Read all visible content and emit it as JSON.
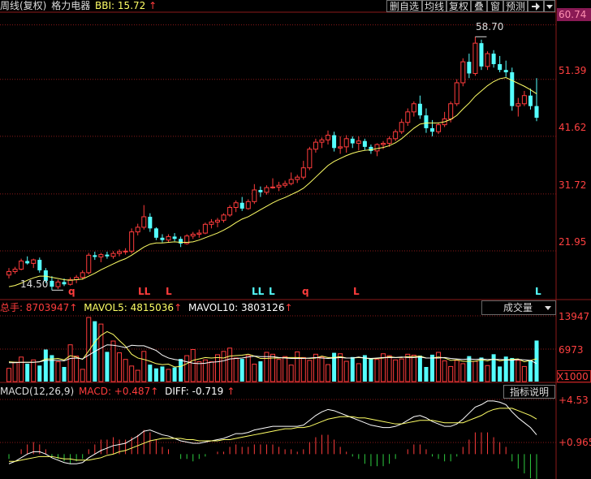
{
  "header": {
    "title": "周线(复权)",
    "stock_name": "格力电器",
    "indicator_label": "BBI:",
    "indicator_value": "15.72",
    "up_arrow": "↑"
  },
  "toolbar": {
    "buttons": [
      "删自选",
      "均线",
      "复权",
      "叠",
      "窗",
      "预测"
    ],
    "pin_icon": "pin-icon",
    "dropdown_icon": "triangle-down-icon"
  },
  "price_axis": {
    "top_value": "60.74",
    "ticks": [
      "51.39",
      "41.62",
      "31.72",
      "21.95"
    ]
  },
  "annotations": {
    "high_label": "58.70",
    "low_label": "14.50",
    "signals": [
      "q",
      "LL",
      "L",
      "LL",
      "L",
      "q",
      "L",
      "L"
    ]
  },
  "volume": {
    "total_label": "总手: 8703947",
    "mavol5_label": "MAVOL5: 4815036",
    "mavol10_label": "MAVOL10: 3803126",
    "selector": "成交量",
    "ticks": [
      "13947",
      "6973",
      "X1000"
    ]
  },
  "macd": {
    "title": "MACD(12,26,9)",
    "macd_label": "MACD: +0.487",
    "diff_label": "DIFF: -0.719",
    "button": "指标说明",
    "ticks": [
      "+4.53",
      "+0.965"
    ]
  },
  "colors": {
    "up": "#ff3c3c",
    "down": "#54ffff",
    "ma": "#ffff66",
    "white": "#ffffff",
    "axis_red": "#ff4040",
    "grid": "#8b1a1a",
    "highlight": "#8a1a55"
  },
  "chart_data": {
    "type": "candlestick",
    "ohlc": [
      [
        17.8,
        19.0,
        17.2,
        18.4
      ],
      [
        18.4,
        19.2,
        18.0,
        18.8
      ],
      [
        18.8,
        20.6,
        18.6,
        20.2
      ],
      [
        20.2,
        21.0,
        19.6,
        19.8
      ],
      [
        19.8,
        20.6,
        19.0,
        20.4
      ],
      [
        20.4,
        20.8,
        18.2,
        18.6
      ],
      [
        18.6,
        19.0,
        16.4,
        16.8
      ],
      [
        16.8,
        17.6,
        15.2,
        15.8
      ],
      [
        15.8,
        17.0,
        15.4,
        16.6
      ],
      [
        16.6,
        17.2,
        15.9,
        16.2
      ],
      [
        16.2,
        17.4,
        16.0,
        17.0
      ],
      [
        17.0,
        17.8,
        16.4,
        17.4
      ],
      [
        17.4,
        18.6,
        17.0,
        18.2
      ],
      [
        18.2,
        21.6,
        17.9,
        21.2
      ],
      [
        21.2,
        21.8,
        20.4,
        20.9
      ],
      [
        20.9,
        21.6,
        20.0,
        21.3
      ],
      [
        21.3,
        21.8,
        20.6,
        21.0
      ],
      [
        21.0,
        21.9,
        20.6,
        21.5
      ],
      [
        21.5,
        22.2,
        21.0,
        21.8
      ],
      [
        21.8,
        22.4,
        21.3,
        21.9
      ],
      [
        21.9,
        25.8,
        21.5,
        25.2
      ],
      [
        25.2,
        26.6,
        24.6,
        26.0
      ],
      [
        26.0,
        29.8,
        25.6,
        27.8
      ],
      [
        27.8,
        28.4,
        25.2,
        25.8
      ],
      [
        25.8,
        26.0,
        23.8,
        24.2
      ],
      [
        24.2,
        24.8,
        23.4,
        23.8
      ],
      [
        23.8,
        24.8,
        23.4,
        24.4
      ],
      [
        24.4,
        25.0,
        23.6,
        24.0
      ],
      [
        24.0,
        24.4,
        22.6,
        23.2
      ],
      [
        23.2,
        24.8,
        23.0,
        24.5
      ],
      [
        24.5,
        25.2,
        24.0,
        24.8
      ],
      [
        24.8,
        25.6,
        24.2,
        25.0
      ],
      [
        25.0,
        26.8,
        24.8,
        26.5
      ],
      [
        26.5,
        27.4,
        25.8,
        26.9
      ],
      [
        26.9,
        27.6,
        26.0,
        27.2
      ],
      [
        27.2,
        28.4,
        26.8,
        28.1
      ],
      [
        28.1,
        29.8,
        27.8,
        29.4
      ],
      [
        29.4,
        30.6,
        28.6,
        30.2
      ],
      [
        30.2,
        31.2,
        28.8,
        29.2
      ],
      [
        29.2,
        30.8,
        29.0,
        30.4
      ],
      [
        30.4,
        33.4,
        30.0,
        32.4
      ],
      [
        32.4,
        33.0,
        31.2,
        32.0
      ],
      [
        32.0,
        33.2,
        31.6,
        32.8
      ],
      [
        32.8,
        34.4,
        32.6,
        32.9
      ],
      [
        32.9,
        33.8,
        32.2,
        33.2
      ],
      [
        33.2,
        34.0,
        32.8,
        33.5
      ],
      [
        33.5,
        35.4,
        33.2,
        34.2
      ],
      [
        34.2,
        35.0,
        33.6,
        34.6
      ],
      [
        34.6,
        37.4,
        34.2,
        36.2
      ],
      [
        36.2,
        39.8,
        35.8,
        39.4
      ],
      [
        39.4,
        41.2,
        38.8,
        40.6
      ],
      [
        40.6,
        41.4,
        39.6,
        41.0
      ],
      [
        41.0,
        42.6,
        40.2,
        41.8
      ],
      [
        41.8,
        42.4,
        39.0,
        39.6
      ],
      [
        39.6,
        41.6,
        38.6,
        39.8
      ],
      [
        39.8,
        41.8,
        38.8,
        41.2
      ],
      [
        41.2,
        41.6,
        39.6,
        40.4
      ],
      [
        40.4,
        41.6,
        39.2,
        40.8
      ],
      [
        40.8,
        41.2,
        39.2,
        39.8
      ],
      [
        39.8,
        40.2,
        38.6,
        39.1
      ],
      [
        39.1,
        40.4,
        38.2,
        40.2
      ],
      [
        40.2,
        40.8,
        39.4,
        40.4
      ],
      [
        40.4,
        41.6,
        39.8,
        41.2
      ],
      [
        41.2,
        42.8,
        40.8,
        42.4
      ],
      [
        42.4,
        44.6,
        42.0,
        44.0
      ],
      [
        44.0,
        46.4,
        43.4,
        45.8
      ],
      [
        45.8,
        47.6,
        45.0,
        47.2
      ],
      [
        47.2,
        48.6,
        44.6,
        45.2
      ],
      [
        45.2,
        46.4,
        42.2,
        43.0
      ],
      [
        43.0,
        44.4,
        41.6,
        42.4
      ],
      [
        42.4,
        44.0,
        42.0,
        43.6
      ],
      [
        43.6,
        45.8,
        43.2,
        44.6
      ],
      [
        44.6,
        47.6,
        44.0,
        47.2
      ],
      [
        47.2,
        51.4,
        46.8,
        50.8
      ],
      [
        50.8,
        55.0,
        50.2,
        54.4
      ],
      [
        54.4,
        55.8,
        51.6,
        52.4
      ],
      [
        52.4,
        58.7,
        52.0,
        57.6
      ],
      [
        57.6,
        58.2,
        53.0,
        53.6
      ],
      [
        53.6,
        56.2,
        53.0,
        55.8
      ],
      [
        55.8,
        56.4,
        53.4,
        54.0
      ],
      [
        54.0,
        55.4,
        52.6,
        53.0
      ],
      [
        53.0,
        54.6,
        51.8,
        52.6
      ],
      [
        52.6,
        53.4,
        46.0,
        46.8
      ],
      [
        46.8,
        48.2,
        45.0,
        47.2
      ],
      [
        47.2,
        49.4,
        46.8,
        48.6
      ],
      [
        48.6,
        49.8,
        46.2,
        46.8
      ],
      [
        46.8,
        51.6,
        44.2,
        44.8
      ]
    ],
    "bbi": [
      15.8,
      16.0,
      16.4,
      16.9,
      17.3,
      17.6,
      17.6,
      17.4,
      17.2,
      17.0,
      16.9,
      17.0,
      17.1,
      17.6,
      18.1,
      18.7,
      19.2,
      19.7,
      20.2,
      20.6,
      21.2,
      21.9,
      22.6,
      23.1,
      23.3,
      23.3,
      23.4,
      23.5,
      23.4,
      23.4,
      23.5,
      23.8,
      24.2,
      24.6,
      25.0,
      25.5,
      26.1,
      26.8,
      27.4,
      27.8,
      28.4,
      29.0,
      29.6,
      30.2,
      30.7,
      31.1,
      31.6,
      32.1,
      32.7,
      33.6,
      34.6,
      35.6,
      36.6,
      37.3,
      37.8,
      38.3,
      38.7,
      39.0,
      39.2,
      39.3,
      39.5,
      39.7,
      40.0,
      40.5,
      41.2,
      42.1,
      43.0,
      43.7,
      43.9,
      43.9,
      43.9,
      44.1,
      44.5,
      45.2,
      46.3,
      47.3,
      48.5,
      49.4,
      50.3,
      51.0,
      51.5,
      51.7,
      51.2,
      50.7,
      50.2,
      49.6,
      48.9
    ],
    "volume": [
      2800,
      4100,
      5200,
      3800,
      4600,
      3400,
      6800,
      5600,
      4200,
      3100,
      7800,
      5400,
      2600,
      13600,
      12800,
      12200,
      6300,
      8600,
      6100,
      4700,
      3300,
      2400,
      6400,
      3600,
      2800,
      3200,
      2600,
      3000,
      4800,
      5500,
      6800,
      4200,
      4600,
      4200,
      5700,
      6400,
      7100,
      5000,
      4800,
      5500,
      3700,
      4300,
      6200,
      5800,
      4700,
      5300,
      3500,
      6300,
      5100,
      4500,
      5800,
      5200,
      3600,
      6100,
      5900,
      4300,
      5200,
      3800,
      5600,
      5000,
      4700,
      5900,
      5500,
      4600,
      4800,
      5800,
      5600,
      5500,
      3100,
      5700,
      6200,
      4400,
      3200,
      4500,
      3800,
      5400,
      4300,
      5100,
      3400,
      5800,
      3200,
      5300,
      5000,
      4500,
      3200,
      4500,
      8703
    ],
    "mavol5": [
      4200,
      4100,
      4100,
      4100,
      4100,
      4200,
      4800,
      4800,
      4900,
      4600,
      5500,
      5200,
      4700,
      6500,
      8400,
      9800,
      10600,
      10000,
      8700,
      7500,
      5800,
      5000,
      4700,
      4300,
      3800,
      3600,
      3700,
      3100,
      3200,
      3800,
      4500,
      4800,
      5100,
      5000,
      5100,
      5000,
      5400,
      5500,
      5600,
      5800,
      5400,
      4900,
      4900,
      5000,
      5000,
      5100,
      5100,
      5100,
      5000,
      4900,
      5000,
      5400,
      5100,
      5100,
      5300,
      5000,
      5000,
      5100,
      5000,
      4800,
      4900,
      5000,
      5300,
      5100,
      5100,
      5300,
      5300,
      5400,
      5000,
      5000,
      5200,
      5000,
      4500,
      4600,
      4300,
      4300,
      4300,
      4600,
      4400,
      4800,
      4400,
      4600,
      4700,
      4800,
      4200,
      4500,
      4815
    ],
    "mavol10": [
      4000,
      4000,
      4100,
      4100,
      4100,
      4200,
      4500,
      4500,
      4500,
      4400,
      4900,
      5000,
      4800,
      5600,
      6400,
      7100,
      7800,
      7700,
      7500,
      7200,
      7700,
      7600,
      7600,
      7100,
      6600,
      5600,
      5000,
      4700,
      4500,
      4200,
      3900,
      3800,
      3900,
      4100,
      4200,
      4400,
      4800,
      4900,
      5000,
      5200,
      5400,
      5300,
      5300,
      5300,
      5100,
      5000,
      4900,
      4900,
      4900,
      5000,
      5100,
      5000,
      4900,
      5000,
      5100,
      5000,
      5000,
      5200,
      5000,
      4900,
      5000,
      5100,
      5100,
      5100,
      5200,
      5100,
      5100,
      5200,
      5000,
      5000,
      5000,
      5100,
      4900,
      4800,
      4700,
      4800,
      4700,
      4800,
      4700,
      4700,
      4700,
      4600,
      4500,
      4700,
      4600,
      4500,
      3803
    ],
    "dif": [
      -0.8,
      -0.6,
      -0.3,
      0.0,
      0.2,
      0.2,
      0.0,
      -0.3,
      -0.5,
      -0.7,
      -0.8,
      -0.8,
      -0.7,
      -0.3,
      0.0,
      0.3,
      0.5,
      0.7,
      0.8,
      0.9,
      1.2,
      1.5,
      1.9,
      2.0,
      1.8,
      1.6,
      1.5,
      1.3,
      1.1,
      1.0,
      0.9,
      0.9,
      1.0,
      1.1,
      1.2,
      1.3,
      1.5,
      1.7,
      1.7,
      1.8,
      2.0,
      2.1,
      2.2,
      2.3,
      2.3,
      2.3,
      2.3,
      2.3,
      2.4,
      2.8,
      3.2,
      3.5,
      3.7,
      3.6,
      3.4,
      3.2,
      3.0,
      2.8,
      2.6,
      2.4,
      2.3,
      2.2,
      2.2,
      2.3,
      2.5,
      2.8,
      3.1,
      3.2,
      3.0,
      2.7,
      2.5,
      2.3,
      2.3,
      2.5,
      2.9,
      3.4,
      3.9,
      4.1,
      4.4,
      4.4,
      4.3,
      4.1,
      3.5,
      3.0,
      2.6,
      2.2,
      1.6
    ],
    "dea": [
      -0.6,
      -0.6,
      -0.5,
      -0.4,
      -0.3,
      -0.2,
      -0.2,
      -0.2,
      -0.3,
      -0.4,
      -0.4,
      -0.5,
      -0.5,
      -0.5,
      -0.4,
      -0.3,
      -0.1,
      0.0,
      0.2,
      0.3,
      0.5,
      0.7,
      0.9,
      1.1,
      1.2,
      1.3,
      1.3,
      1.3,
      1.3,
      1.2,
      1.2,
      1.1,
      1.1,
      1.1,
      1.1,
      1.2,
      1.2,
      1.3,
      1.4,
      1.5,
      1.6,
      1.7,
      1.8,
      1.9,
      2.0,
      2.1,
      2.1,
      2.2,
      2.2,
      2.3,
      2.5,
      2.7,
      2.9,
      3.0,
      3.1,
      3.1,
      3.1,
      3.0,
      3.0,
      2.9,
      2.8,
      2.7,
      2.6,
      2.5,
      2.5,
      2.6,
      2.7,
      2.8,
      2.8,
      2.8,
      2.7,
      2.6,
      2.6,
      2.6,
      2.6,
      2.8,
      3.0,
      3.2,
      3.5,
      3.7,
      3.8,
      3.8,
      3.8,
      3.6,
      3.4,
      3.2,
      2.9
    ],
    "ylim_price": [
      14.0,
      62.5
    ],
    "ylim_macd": [
      -2.0,
      4.8
    ]
  }
}
